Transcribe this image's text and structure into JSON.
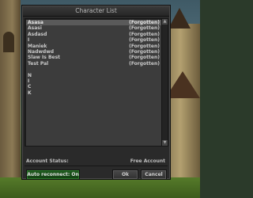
{
  "dialog": {
    "title": "Character List"
  },
  "characters": [
    {
      "name": "Asasa",
      "status": "(Forgotten)",
      "selected": true
    },
    {
      "name": "Asasi",
      "status": "(Forgotten)"
    },
    {
      "name": "Asdasd",
      "status": "(Forgotten)"
    },
    {
      "name": "I",
      "status": "(Forgotten)"
    },
    {
      "name": "Maniek",
      "status": "(Forgotten)"
    },
    {
      "name": "Nadwdwd",
      "status": "(Forgotten)"
    },
    {
      "name": "Slaw Is Best",
      "status": "(Forgotten)"
    },
    {
      "name": "Test Pal",
      "status": "(Forgotten)"
    },
    {
      "name": "",
      "status": ""
    },
    {
      "name": "N",
      "status": ""
    },
    {
      "name": "I",
      "status": ""
    },
    {
      "name": "C",
      "status": ""
    },
    {
      "name": "K",
      "status": ""
    }
  ],
  "account": {
    "label": "Account Status:",
    "value": "Free Account"
  },
  "buttons": {
    "auto_reconnect": "Auto reconnect: On",
    "ok": "Ok",
    "cancel": "Cancel"
  },
  "colors": {
    "dialog_bg": "#2a2a2a",
    "list_bg": "#3c3c3c",
    "selected_row": "#5a5a5a",
    "green_button": "#1e5a1e"
  },
  "icons": {
    "scroll_up": "triangle-up-icon",
    "scroll_down": "triangle-down-icon"
  }
}
